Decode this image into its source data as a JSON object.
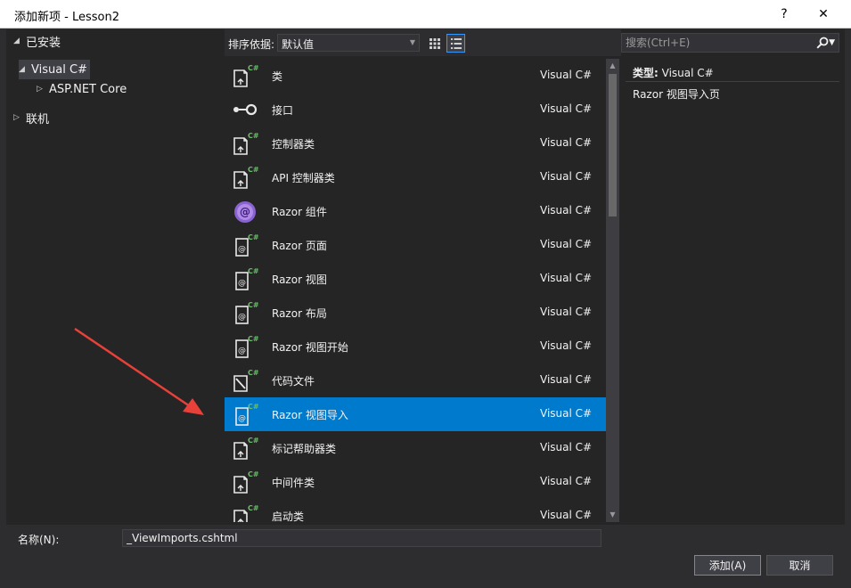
{
  "window": {
    "title": "添加新项 - Lesson2",
    "help_label": "?",
    "close_label": "✕"
  },
  "tree": {
    "installed": "已安装",
    "visual_csharp": "Visual C#",
    "aspnet_core": "ASP.NET Core",
    "online": "联机"
  },
  "toolbar": {
    "sort_label": "排序依据:",
    "sort_value": "默认值"
  },
  "search": {
    "placeholder": "搜索(Ctrl+E)"
  },
  "items": [
    {
      "name": "类",
      "lang": "Visual C#",
      "icon": "class-icon"
    },
    {
      "name": "接口",
      "lang": "Visual C#",
      "icon": "interface-icon"
    },
    {
      "name": "控制器类",
      "lang": "Visual C#",
      "icon": "class-icon"
    },
    {
      "name": "API 控制器类",
      "lang": "Visual C#",
      "icon": "class-icon"
    },
    {
      "name": "Razor 组件",
      "lang": "Visual C#",
      "icon": "razor-component-icon"
    },
    {
      "name": "Razor 页面",
      "lang": "Visual C#",
      "icon": "razor-file-icon"
    },
    {
      "name": "Razor 视图",
      "lang": "Visual C#",
      "icon": "razor-file-icon"
    },
    {
      "name": "Razor 布局",
      "lang": "Visual C#",
      "icon": "razor-file-icon"
    },
    {
      "name": "Razor 视图开始",
      "lang": "Visual C#",
      "icon": "razor-file-icon"
    },
    {
      "name": "代码文件",
      "lang": "Visual C#",
      "icon": "code-file-icon"
    },
    {
      "name": "Razor 视图导入",
      "lang": "Visual C#",
      "icon": "razor-file-icon"
    },
    {
      "name": "标记帮助器类",
      "lang": "Visual C#",
      "icon": "class-icon"
    },
    {
      "name": "中间件类",
      "lang": "Visual C#",
      "icon": "class-icon"
    },
    {
      "name": "启动类",
      "lang": "Visual C#",
      "icon": "class-icon"
    }
  ],
  "selected_index": 10,
  "details": {
    "type_label": "类型:",
    "type_value": "Visual C#",
    "description": "Razor 视图导入页"
  },
  "bottom": {
    "name_label": "名称(N):",
    "name_value": "_ViewImports.cshtml",
    "add_label": "添加(A)",
    "cancel_label": "取消"
  },
  "colors": {
    "selection": "#007acc",
    "csharp_badge": "#6abf69",
    "annotation_arrow": "#e8413a",
    "razor_purple": "#8a63d2"
  }
}
